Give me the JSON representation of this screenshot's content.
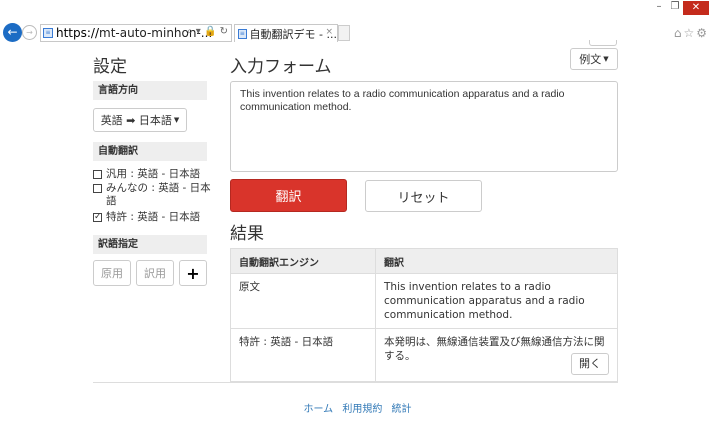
{
  "browser": {
    "url_scheme": "https://",
    "url_rest": "mt-auto-minhon-...",
    "url_icons": "⌕ ▾ 🔒 ↻",
    "tab_title": "自動翻訳デモ - ...",
    "tab_close": "×",
    "win_min": "–",
    "win_max": "❐",
    "win_close": "✕",
    "right_icons": "⌂☆⚙"
  },
  "sidebar": {
    "title": "設定",
    "direction_label": "言語方向",
    "direction_button": "英語 ➡ 日本語",
    "auto_label": "自動翻訳",
    "engines": [
      {
        "label": "汎用 : 英語 - 日本語",
        "checked": false
      },
      {
        "label": "みんなの : 英語 - 日本語",
        "checked": false
      },
      {
        "label": "特許 : 英語 - 日本語",
        "checked": true
      }
    ],
    "glossary_label": "訳語指定",
    "source_button": "原用",
    "target_button": "訳用",
    "add_button": "+"
  },
  "main": {
    "title": "入力フォーム",
    "example_button": "例文",
    "input_text": "This invention relates to a radio communication apparatus and a radio communication method.",
    "translate_button": "翻訳",
    "reset_button": "リセット",
    "result_title": "結果",
    "table": {
      "headers": [
        "自動翻訳エンジン",
        "翻訳"
      ],
      "rows": [
        {
          "engine": "原文",
          "translation": "This invention relates to a radio communication apparatus and a radio communication method."
        },
        {
          "engine": "特許 : 英語 - 日本語",
          "translation": "本発明は、無線通信装置及び無線通信方法に関する。",
          "button": "開く"
        }
      ]
    }
  },
  "footer": {
    "links": [
      "ホーム",
      "利用規約",
      "統計"
    ]
  },
  "colors": {
    "accent_red": "#d9342b",
    "link_blue": "#337ab7"
  }
}
